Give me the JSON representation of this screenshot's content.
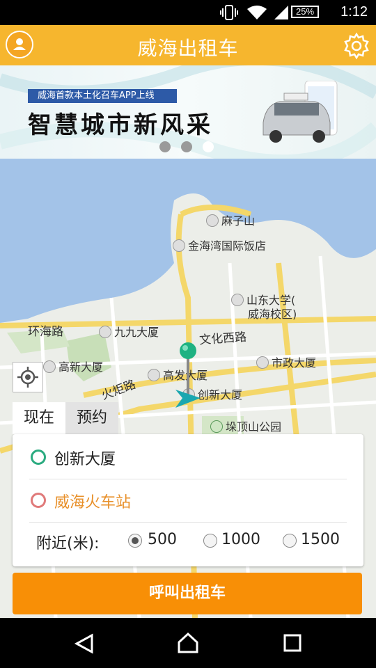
{
  "status_bar": {
    "battery": "25%",
    "time": "1:12"
  },
  "header": {
    "title": "威海出租车"
  },
  "banner": {
    "tagline": "威海首款本土化召车APP上线",
    "slogan": "智慧城市新风采",
    "dots": 3,
    "active_dot": 2
  },
  "map": {
    "places": [
      "麻子山",
      "金海湾国际饭店",
      "山东大学(",
      "威海校区)",
      "九九大厦",
      "高新大厦",
      "高发大厦",
      "创新大厦",
      "市政大厦",
      "垛顶山公园"
    ],
    "roads": [
      "环海路",
      "文化西路",
      "火炬路"
    ]
  },
  "tabs": {
    "now": "现在",
    "reserve": "预约"
  },
  "panel": {
    "origin": "创新大厦",
    "destination": "威海火车站",
    "nearby_label": "附近(米):",
    "radius_options": [
      "500",
      "1000",
      "1500"
    ],
    "selected_radius": "500"
  },
  "call_button": "呼叫出租车",
  "colors": {
    "header": "#f6b62e",
    "call_button": "#f88f06",
    "origin_ring": "#2bab80",
    "destination_ring": "#e07a7a",
    "destination_text": "#e8902a",
    "water": "#a3c3e8"
  }
}
